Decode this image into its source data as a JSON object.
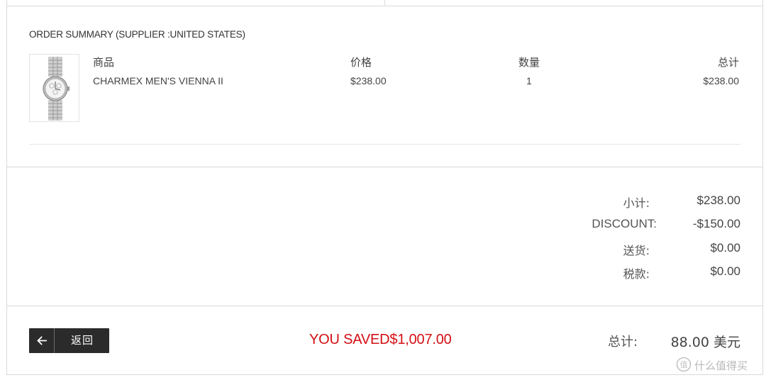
{
  "summary": {
    "title": "ORDER SUMMARY (SUPPLIER :UNITED STATES)"
  },
  "table": {
    "headers": {
      "product": "商品",
      "price": "价格",
      "quantity": "数量",
      "total": "总计"
    },
    "rows": [
      {
        "product": "CHARMEX MEN'S VIENNA II",
        "price": "$238.00",
        "quantity": "1",
        "total": "$238.00",
        "thumbnail_icon": "watch-image"
      }
    ]
  },
  "totals": {
    "subtotal_label": "小计:",
    "subtotal_value": "$238.00",
    "discount_label": "DISCOUNT:",
    "discount_value": "-$150.00",
    "shipping_label": "送货:",
    "shipping_value": "$0.00",
    "tax_label": "税款:",
    "tax_value": "$0.00"
  },
  "footer": {
    "back_label": "返回",
    "back_icon": "arrow-left-icon",
    "saved_text": "YOU SAVED$1,007.00",
    "grand_total_label": "总计:",
    "grand_total_value": "88.00 美元"
  },
  "watermark": {
    "text": "什么值得买",
    "icon": "smzdm-logo-icon"
  },
  "colors": {
    "saved": "#d40f14",
    "button_bg": "#2b2b2b",
    "border": "#d9d9d9"
  }
}
